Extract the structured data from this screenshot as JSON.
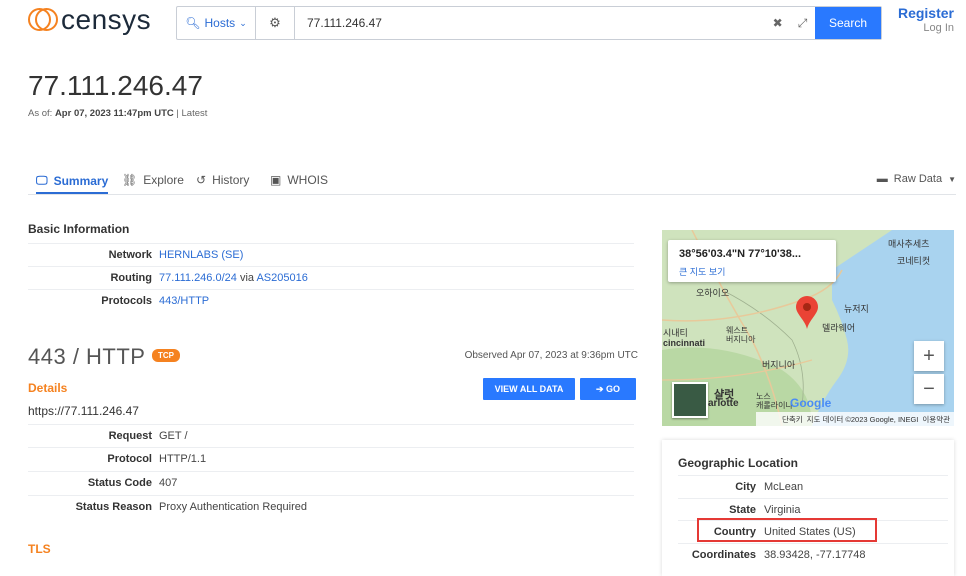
{
  "header": {
    "logo_text": "censys",
    "search_type": "Hosts",
    "query": "77.111.246.47",
    "search_label": "Search",
    "register_label": "Register",
    "login_label": "Log In"
  },
  "host": {
    "ip": "77.111.246.47",
    "asof_prefix": "As of:",
    "asof_date": "Apr 07, 2023 11:47pm UTC",
    "asof_suffix": "| Latest"
  },
  "tabs": [
    {
      "label": "Summary",
      "icon": "monitor-icon"
    },
    {
      "label": "Explore",
      "icon": "binoculars-icon"
    },
    {
      "label": "History",
      "icon": "history-icon"
    },
    {
      "label": "WHOIS",
      "icon": "document-icon"
    }
  ],
  "raw_data_label": "Raw Data",
  "basic_info": {
    "title": "Basic Information",
    "network_key": "Network",
    "network_value": "HERNLABS (SE)",
    "routing_key": "Routing",
    "routing_prefix": "77.111.246.0/24",
    "routing_via": "via",
    "routing_as": "AS205016",
    "protocols_key": "Protocols",
    "protocols_value": "443/HTTP"
  },
  "service": {
    "title": "443 / HTTP",
    "badge": "TCP",
    "observed": "Observed Apr 07, 2023 at 9:36pm UTC",
    "details_title": "Details",
    "view_all_label": "VIEW ALL DATA",
    "go_label": "GO",
    "url": "https://77.111.246.47",
    "rows": [
      {
        "key": "Request",
        "value": "GET /"
      },
      {
        "key": "Protocol",
        "value": "HTTP/1.1"
      },
      {
        "key": "Status Code",
        "value": "407"
      },
      {
        "key": "Status Reason",
        "value": "Proxy Authentication Required"
      }
    ],
    "tls_title": "TLS"
  },
  "map": {
    "coords": "38°56'03.4\"N 77°10'38...",
    "larger_map": "큰 지도 보기",
    "google": "Google",
    "footer_shortcuts": "단축키",
    "footer_data": "지도 데이터 ©2023 Google, INEGI",
    "footer_terms": "이용약관",
    "labels": {
      "ohio": "오하이오",
      "cincinnati_ko": "시내티",
      "cincinnati_en": "cincinnati",
      "wv_ko": "웨스트\n버지니아",
      "virginia": "버지니아",
      "charlotte_ko": "샬럿",
      "charlotte_en": "arlotte",
      "nc": "노스\n캐롤라이나",
      "nj": "뉴저지",
      "de": "델라웨어",
      "ma": "매사추세츠",
      "ct": "코네티컷"
    }
  },
  "geo": {
    "title": "Geographic Location",
    "rows": [
      {
        "key": "City",
        "value": "McLean"
      },
      {
        "key": "State",
        "value": "Virginia"
      },
      {
        "key": "Country",
        "value": "United States (US)"
      },
      {
        "key": "Coordinates",
        "value": "38.93428, -77.17748"
      }
    ]
  },
  "colors": {
    "accent": "#2979ff",
    "orange": "#f58220",
    "highlight": "#e53935"
  }
}
